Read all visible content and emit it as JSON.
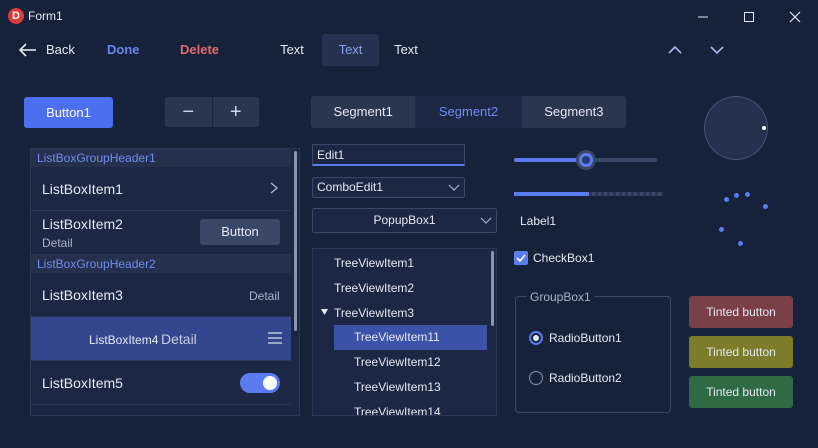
{
  "window": {
    "title": "Form1",
    "icon_letter": "D",
    "controls": [
      "minimize-icon",
      "maximize-icon",
      "close-icon"
    ]
  },
  "toolbar": {
    "back_label": "Back",
    "done_label": "Done",
    "delete_label": "Delete",
    "segments": [
      "Text",
      "Text",
      "Text"
    ],
    "active_segment_index": 1,
    "up_icon": "chevron-up-icon",
    "down_icon": "chevron-down-icon"
  },
  "controls_row": {
    "button1_label": "Button1",
    "stepper_minus": "−",
    "stepper_plus": "+",
    "segments": [
      "Segment1",
      "Segment2",
      "Segment3"
    ],
    "active_segment_index": 1
  },
  "listbox": {
    "group1_header": "ListBoxGroupHeader1",
    "item1_title": "ListBoxItem1",
    "item2_title": "ListBoxItem2",
    "item2_detail": "Detail",
    "item2_button": "Button",
    "group2_header": "ListBoxGroupHeader2",
    "item3_title": "ListBoxItem3",
    "item3_detail": "Detail",
    "item4_title": "ListBoxItem4",
    "item4_detail": "Detail",
    "item5_title": "ListBoxItem5",
    "item5_toggle_on": true
  },
  "inputs": {
    "edit_value": "Edit1",
    "combo_value": "ComboEdit1",
    "popup_value": "PopupBox1"
  },
  "tree": {
    "items": [
      {
        "label": "TreeViewItem1",
        "level": 0
      },
      {
        "label": "TreeViewItem2",
        "level": 0
      },
      {
        "label": "TreeViewItem3",
        "level": 0,
        "expanded": true
      },
      {
        "label": "TreeViewItem11",
        "level": 1,
        "selected": true
      },
      {
        "label": "TreeViewItem12",
        "level": 1
      },
      {
        "label": "TreeViewItem13",
        "level": 1
      },
      {
        "label": "TreeViewItem14",
        "level": 1
      }
    ]
  },
  "right_panel": {
    "slider_value": 0.5,
    "progress_value": 0.5,
    "label": "Label1",
    "checkbox_label": "CheckBox1",
    "checkbox_checked": true,
    "groupbox_title": "GroupBox1",
    "radio1_label": "RadioButton1",
    "radio2_label": "RadioButton2",
    "radio_selected": 1,
    "tinted_buttons": [
      {
        "label": "Tinted button",
        "color": "#7a4048"
      },
      {
        "label": "Tinted button",
        "color": "#7c7c2a"
      },
      {
        "label": "Tinted button",
        "color": "#2f6a44"
      }
    ]
  },
  "colors": {
    "background": "#16213a",
    "accent": "#5a7cf0",
    "done": "#6a86f0",
    "delete": "#e06a6a"
  }
}
